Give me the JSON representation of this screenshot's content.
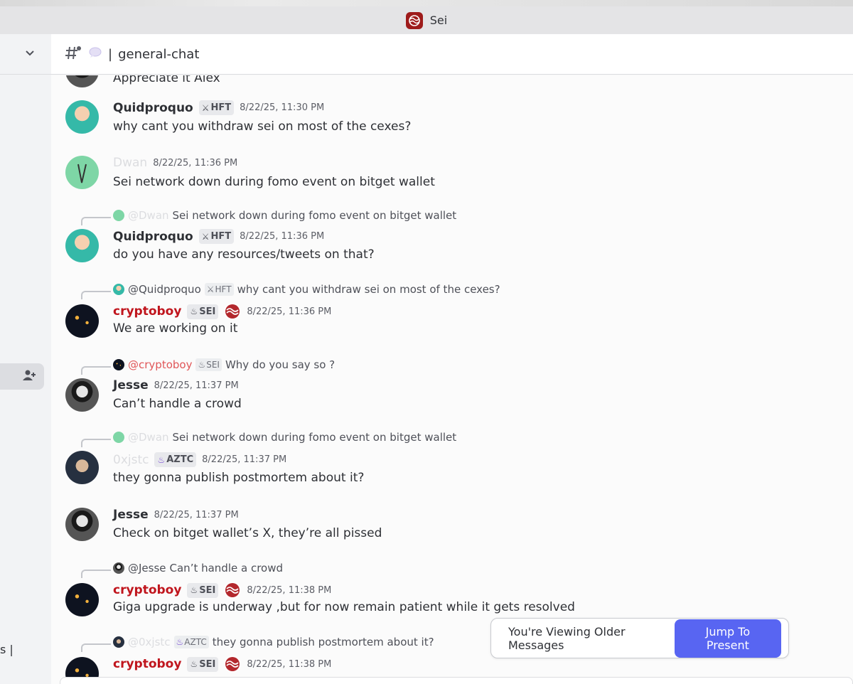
{
  "window": {
    "title": "Sei"
  },
  "channel": {
    "name": "general-chat"
  },
  "sidebar": {
    "truncated_text": "s"
  },
  "banner": {
    "text": "You're Viewing Older Messages",
    "button": "Jump To Present"
  },
  "messages": [
    {
      "partial_body": "Appreciate it Alex"
    },
    {
      "user": "Quidproquo",
      "badge": "HFT",
      "time": "8/22/25, 11:30 PM",
      "body": "why cant you withdraw sei on most of the cexes?"
    },
    {
      "user": "Dwan",
      "time": "8/22/25, 11:36 PM",
      "body": "Sei network down during fomo event on bitget wallet"
    },
    {
      "reply_mention": "@Dwan",
      "reply_text": "Sei network down during fomo event on bitget wallet",
      "user": "Quidproquo",
      "badge": "HFT",
      "time": "8/22/25, 11:36 PM",
      "body": "do you have any resources/tweets on that?"
    },
    {
      "reply_mention": "@Quidproquo",
      "reply_badge": "HFT",
      "reply_text": "why cant you withdraw sei on most of the cexes?",
      "user": "cryptoboy",
      "badge": "SEI",
      "time": "8/22/25, 11:36 PM",
      "body": "We are working on it"
    },
    {
      "reply_mention": "@cryptoboy",
      "reply_badge": "SEI",
      "reply_text": "Why do you say so ?",
      "user": "Jesse",
      "time": "8/22/25, 11:37 PM",
      "body": "Can’t handle a crowd"
    },
    {
      "reply_mention": "@Dwan",
      "reply_text": "Sei network down during fomo event on bitget wallet",
      "user": "0xjstc",
      "badge": "AZTC",
      "time": "8/22/25, 11:37 PM",
      "body": "they gonna publish postmortem about it?"
    },
    {
      "user": "Jesse",
      "time": "8/22/25, 11:37 PM",
      "body": "Check on bitget wallet’s X, they’re all pissed"
    },
    {
      "reply_mention": "@Jesse",
      "reply_text": "Can’t handle a crowd",
      "user": "cryptoboy",
      "badge": "SEI",
      "time": "8/22/25, 11:38 PM",
      "body": "Giga upgrade is underway ,but for now remain patient while it gets resolved"
    },
    {
      "reply_mention": "@0xjstc",
      "reply_badge": "AZTC",
      "reply_text": "they gonna publish postmortem about it?",
      "user": "cryptoboy",
      "badge": "SEI",
      "time": "8/22/25, 11:38 PM"
    }
  ]
}
